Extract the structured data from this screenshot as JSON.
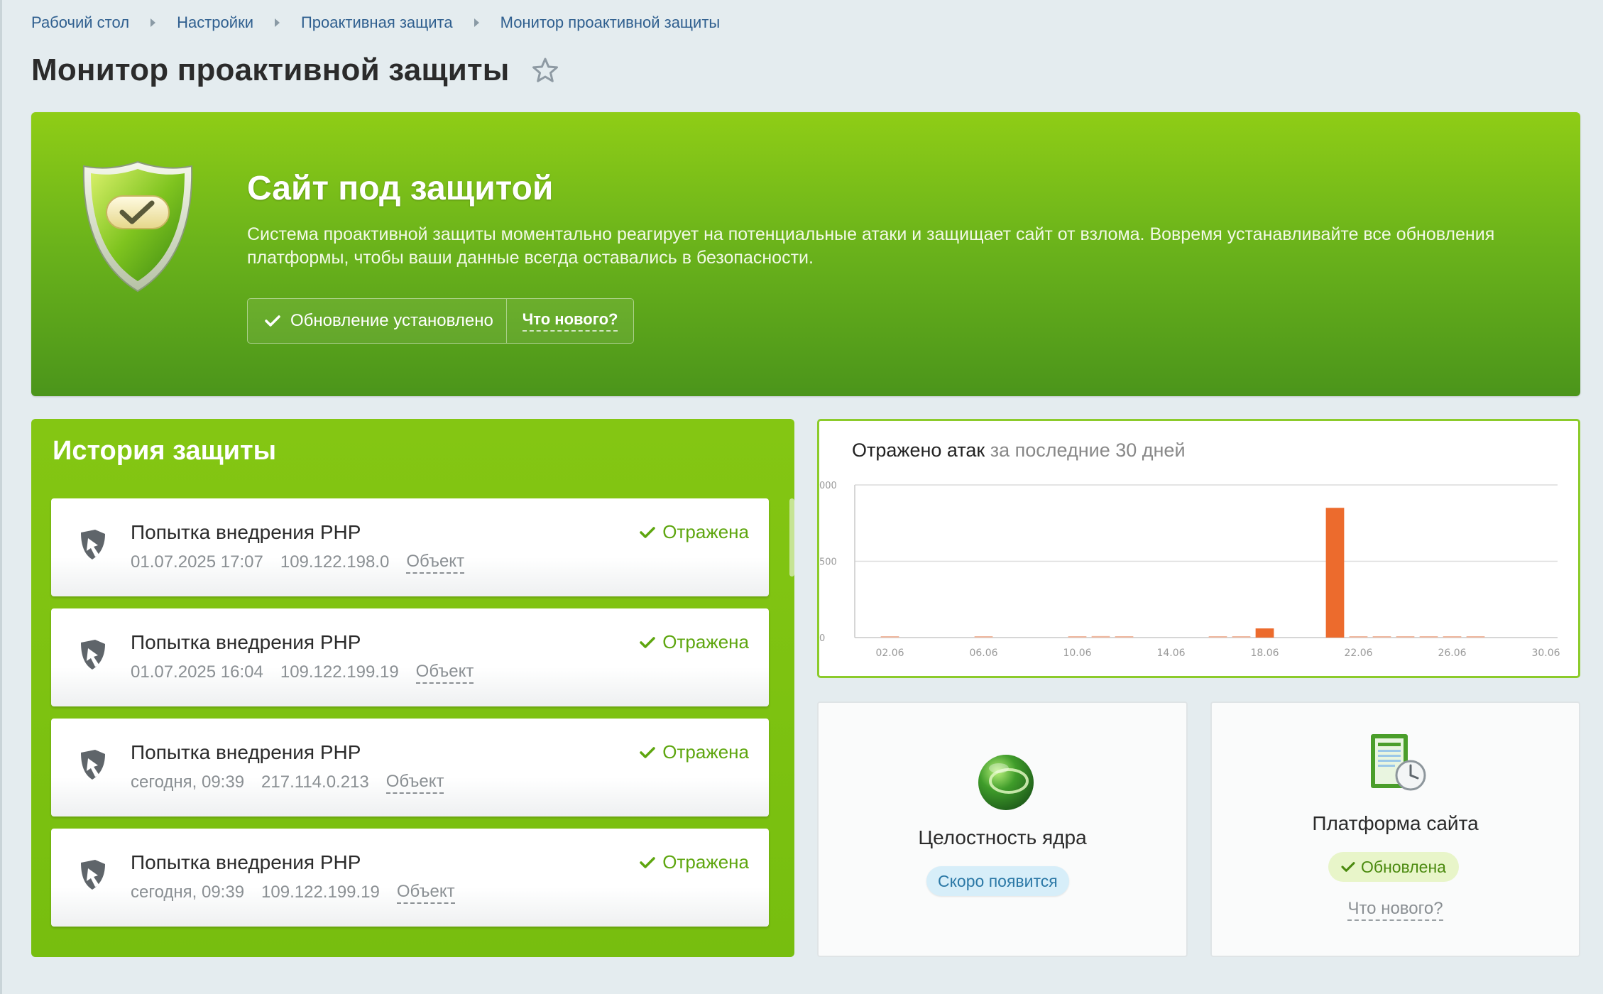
{
  "breadcrumbs": [
    "Рабочий стол",
    "Настройки",
    "Проактивная защита",
    "Монитор проактивной защиты"
  ],
  "page": {
    "title": "Монитор проактивной защиты"
  },
  "hero": {
    "title": "Сайт под защитой",
    "description": "Система проактивной защиты моментально реагирует на потенциальные атаки и защищает сайт от взлома. Вовремя устанавливайте все обновления платформы, чтобы ваши данные всегда оставались в безопасности.",
    "update_status": "Обновление установлено",
    "whats_new": "Что нового?"
  },
  "history": {
    "title": "История защиты",
    "items": [
      {
        "title": "Попытка внедрения PHP",
        "time": "01.07.2025 17:07",
        "ip": "109.122.198.0",
        "object": "Объект",
        "status": "Отражена"
      },
      {
        "title": "Попытка внедрения PHP",
        "time": "01.07.2025 16:04",
        "ip": "109.122.199.19",
        "object": "Объект",
        "status": "Отражена"
      },
      {
        "title": "Попытка внедрения PHP",
        "time": "сегодня, 09:39",
        "ip": "217.114.0.213",
        "object": "Объект",
        "status": "Отражена"
      },
      {
        "title": "Попытка внедрения PHP",
        "time": "сегодня, 09:39",
        "ip": "109.122.199.19",
        "object": "Объект",
        "status": "Отражена"
      }
    ]
  },
  "chart": {
    "heading_bold": "Отражено атак",
    "heading_light": "за последние 30 дней"
  },
  "chart_data": {
    "type": "bar",
    "title": "Отражено атак за последние 30 дней",
    "categories": [
      "01.06",
      "02.06",
      "03.06",
      "04.06",
      "05.06",
      "06.06",
      "07.06",
      "08.06",
      "09.06",
      "10.06",
      "11.06",
      "12.06",
      "13.06",
      "14.06",
      "15.06",
      "16.06",
      "17.06",
      "18.06",
      "19.06",
      "20.06",
      "21.06",
      "22.06",
      "23.06",
      "24.06",
      "25.06",
      "26.06",
      "27.06",
      "28.06",
      "29.06",
      "30.06"
    ],
    "values": [
      0,
      6,
      0,
      0,
      0,
      3,
      0,
      0,
      0,
      3,
      10,
      3,
      0,
      0,
      0,
      3,
      3,
      60,
      0,
      0,
      850,
      3,
      3,
      3,
      6,
      3,
      3,
      0,
      0,
      0
    ],
    "x_tick_labels": [
      "02.06",
      "06.06",
      "10.06",
      "14.06",
      "18.06",
      "22.06",
      "26.06",
      "30.06"
    ],
    "y_tick_labels": [
      "000",
      "500",
      "0"
    ],
    "ylim": [
      0,
      1000
    ],
    "grid": true,
    "bar_color": "#ec6b2d",
    "small_bar_color": "#f0b9a0"
  },
  "kernel": {
    "title": "Целостность ядра",
    "badge": "Скоро появится"
  },
  "platform": {
    "title": "Платформа сайта",
    "badge": "Обновлена",
    "whats_new": "Что нового?"
  },
  "colors": {
    "accent_green": "#77be0f",
    "status_green": "#5ea60f",
    "link_blue": "#2f5f8f"
  }
}
